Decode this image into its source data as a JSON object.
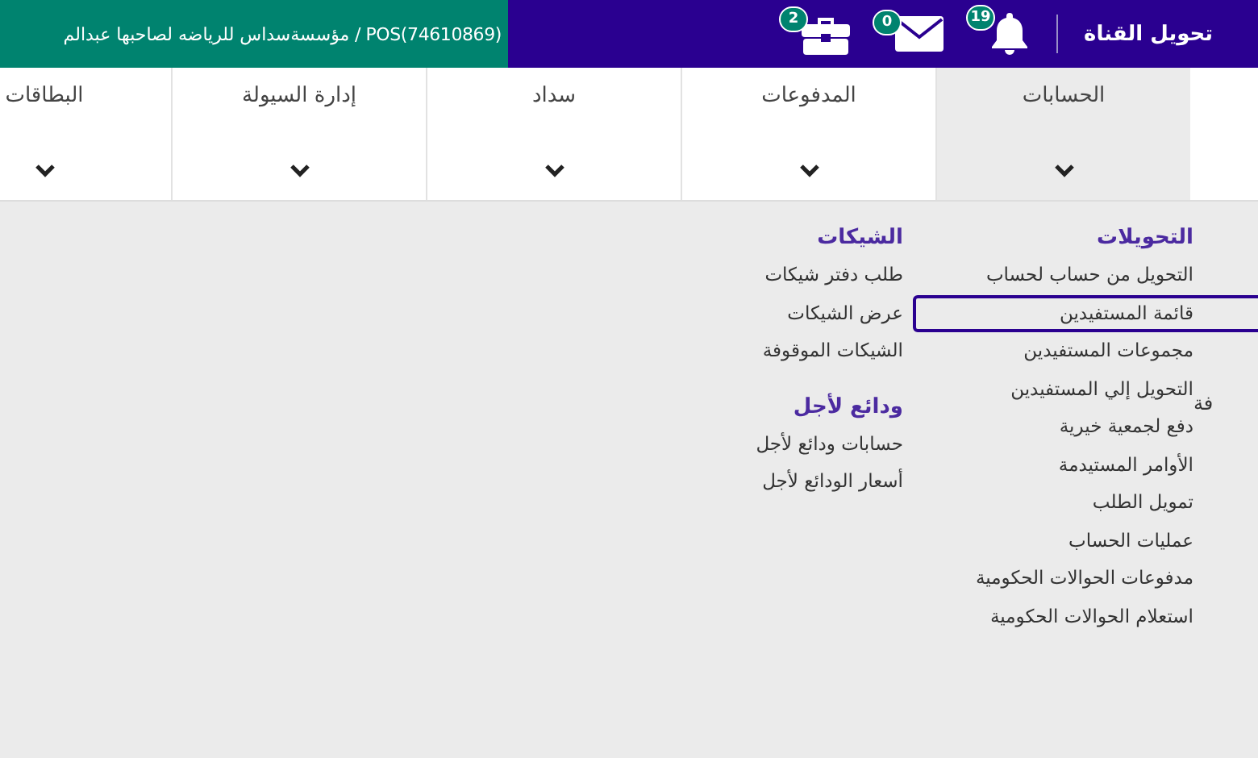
{
  "header": {
    "account_text": "POS(74610869) / مؤسسةسداس للرياضه لصاحبها عبدالم",
    "channel_switch": "تحويل القناة",
    "badges": [
      {
        "kind": "bell",
        "count": "19"
      },
      {
        "kind": "mail",
        "count": "0"
      },
      {
        "kind": "briefcase",
        "count": "2"
      }
    ]
  },
  "tabs": [
    {
      "label": "الحسابات",
      "selected": true
    },
    {
      "label": "المدفوعات",
      "selected": false
    },
    {
      "label": "سداد",
      "selected": false
    },
    {
      "label": "إدارة السيولة",
      "selected": false
    },
    {
      "label": "البطاقات",
      "selected": false
    }
  ],
  "menu": {
    "cut_column_text": "فة",
    "columns": [
      {
        "groups": [
          {
            "title": "التحويلات",
            "items": [
              {
                "label": "التحويل من حساب لحساب",
                "selected": false
              },
              {
                "label": "قائمة المستفيدين",
                "selected": true
              },
              {
                "label": "مجموعات المستفيدين",
                "selected": false
              },
              {
                "label": "التحويل إلي المستفيدين",
                "selected": false
              },
              {
                "label": "دفع لجمعية خيرية",
                "selected": false
              },
              {
                "label": "الأوامر المستيدمة",
                "selected": false
              },
              {
                "label": "تمويل الطلب",
                "selected": false
              },
              {
                "label": "عمليات الحساب",
                "selected": false
              },
              {
                "label": "مدفوعات الحوالات الحكومية",
                "selected": false
              },
              {
                "label": "استعلام الحوالات الحكومية",
                "selected": false
              }
            ]
          }
        ]
      },
      {
        "groups": [
          {
            "title": "الشيكات",
            "items": [
              {
                "label": "طلب دفتر شيكات",
                "selected": false
              },
              {
                "label": "عرض الشيكات",
                "selected": false
              },
              {
                "label": "الشيكات الموقوفة",
                "selected": false
              }
            ]
          },
          {
            "title": "ودائع لأجل",
            "items": [
              {
                "label": "حسابات ودائع لأجل",
                "selected": false
              },
              {
                "label": "أسعار الودائع لأجل",
                "selected": false
              }
            ]
          }
        ]
      }
    ]
  }
}
